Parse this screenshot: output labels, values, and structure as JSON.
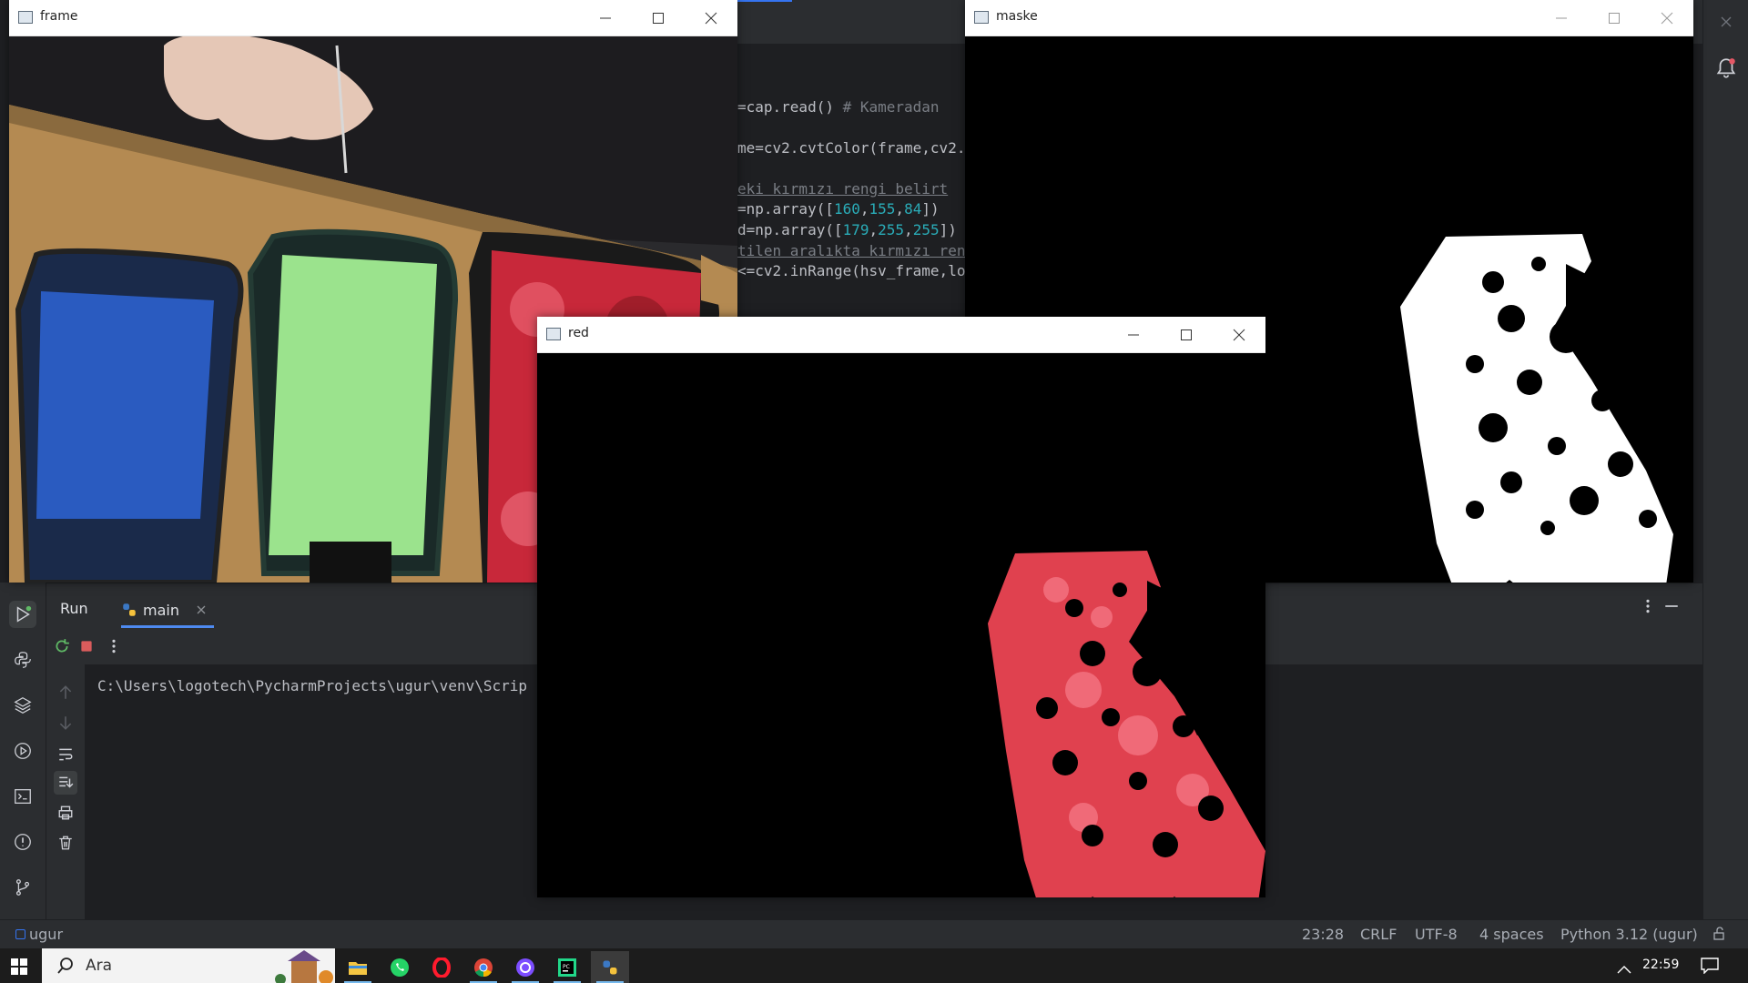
{
  "ide": {
    "code_lines": [
      {
        "pre": "=cap.read()    ",
        "comment": "# Kameradan"
      },
      {
        "pre": "me=cv2.cvtColor(frame,cv2.",
        "comment": ""
      },
      {
        "pre": "",
        "comment": "eki kırmızı rengi belirt"
      },
      {
        "pre": "=np.array([",
        "n1": "160",
        "n2": "155",
        "n3": "84",
        "post": "])"
      },
      {
        "pre": "d=np.array([",
        "n1": "179",
        "n2": "255",
        "n3": "255",
        "post": "])"
      },
      {
        "pre": "",
        "comment": "tilen aralıkta kırmızı ren"
      },
      {
        "pre": "<=cv2.inRange(hsv_frame,lo",
        "comment": ""
      }
    ]
  },
  "run_panel": {
    "title": "Run",
    "tab_label": "main",
    "console_line": "C:\\Users\\logotech\\PycharmProjects\\ugur\\venv\\Scrip"
  },
  "statusbar": {
    "project": "ugur",
    "position": "23:28",
    "line_sep": "CRLF",
    "encoding": "UTF-8",
    "indent": "4 spaces",
    "interpreter": "Python 3.12 (ugur)"
  },
  "taskbar": {
    "search_placeholder": "Ara",
    "time": "22:59"
  },
  "windows": {
    "frame": {
      "title": "frame"
    },
    "maske": {
      "title": "maske"
    },
    "red": {
      "title": "red"
    }
  },
  "colors": {
    "ide_bg": "#1e1f22",
    "panel_bg": "#2b2d30",
    "accent": "#3574f0",
    "mask_white": "#ffffff",
    "red_rose": "#e0414f"
  }
}
